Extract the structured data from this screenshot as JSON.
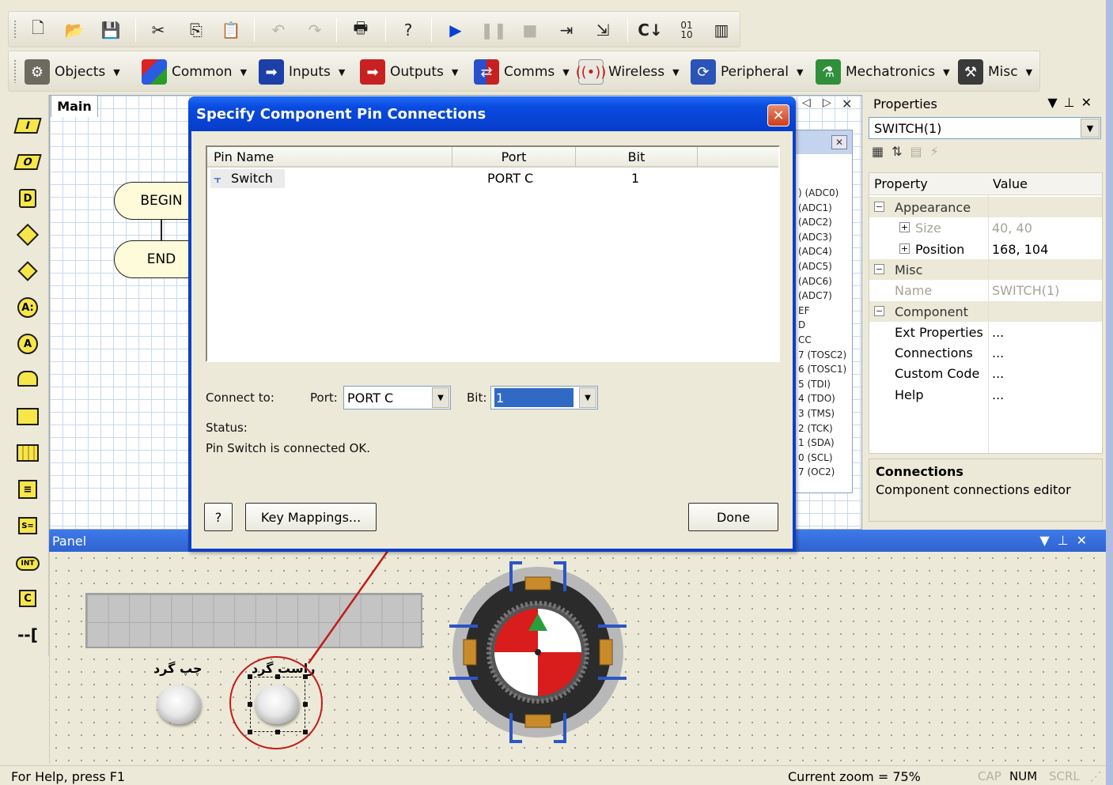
{
  "toolbar_top": {
    "buttons": [
      "new-icon",
      "open-icon",
      "save-icon",
      "cut-icon",
      "copy-icon",
      "paste-icon",
      "undo-icon",
      "redo-icon",
      "print-icon",
      "help-icon",
      "run-icon",
      "pause-icon",
      "stop-icon",
      "step-into-icon",
      "step-over-icon",
      "compile-c-icon",
      "compile-hex-icon",
      "compile-chip-icon"
    ],
    "compile_c_label": "C",
    "hex_label": "01\n10"
  },
  "toolbar_components": {
    "objects": "Objects",
    "common": "Common",
    "inputs": "Inputs",
    "outputs": "Outputs",
    "comms": "Comms",
    "wireless": "Wireless",
    "peripheral": "Peripheral",
    "mechatronics": "Mechatronics",
    "misc": "Misc"
  },
  "palette": {
    "items": [
      "I",
      "O",
      "D",
      "",
      "",
      "A:",
      "A",
      "",
      "",
      "",
      "",
      "S=",
      "INT",
      "C",
      "--["
    ]
  },
  "flowchart": {
    "tab_label": "Main",
    "begin": "BEGIN",
    "end": "END"
  },
  "pin_list": {
    "lines": [
      ") (ADC0)",
      "(ADC1)",
      "(ADC2)",
      "(ADC3)",
      "(ADC4)",
      "(ADC5)",
      "(ADC6)",
      "(ADC7)",
      "EF",
      "D",
      "CC",
      "7 (TOSC2)",
      "6 (TOSC1)",
      "5 (TDI)",
      "4 (TDO)",
      "3 (TMS)",
      "2 (TCK)",
      "1 (SDA)",
      "0 (SCL)",
      "7 (OC2)"
    ]
  },
  "properties": {
    "title": "Properties",
    "component": "SWITCH(1)",
    "col_property": "Property",
    "col_value": "Value",
    "rows": [
      {
        "type": "cat",
        "key": "Appearance"
      },
      {
        "type": "sub",
        "key": "Size",
        "value": "40, 40",
        "dim": true
      },
      {
        "type": "sub",
        "key": "Position",
        "value": "168, 104"
      },
      {
        "type": "cat",
        "key": "Misc"
      },
      {
        "type": "item",
        "key": "Name",
        "value": "SWITCH(1)",
        "dim": true
      },
      {
        "type": "cat",
        "key": "Component"
      },
      {
        "type": "item",
        "key": "Ext Properties",
        "value": "..."
      },
      {
        "type": "item",
        "key": "Connections",
        "value": "..."
      },
      {
        "type": "item",
        "key": "Custom Code",
        "value": "..."
      },
      {
        "type": "item",
        "key": "Help",
        "value": "..."
      }
    ],
    "desc_title": "Connections",
    "desc_text": "Component connections editor"
  },
  "panel": {
    "title": "Panel",
    "label_left": "چپ گرد",
    "label_right": "راست گرد"
  },
  "dialog": {
    "title": "Specify Component Pin Connections",
    "close": "✕",
    "columns": [
      "Pin Name",
      "Port",
      "Bit"
    ],
    "row": {
      "pin": "Switch",
      "port": "PORT C",
      "bit": "1"
    },
    "connect_to": "Connect to:",
    "port_label": "Port:",
    "port_value": "PORT C",
    "bit_label": "Bit:",
    "bit_value": "1",
    "status_label": "Status:",
    "status_text": "Pin Switch is connected OK.",
    "help_btn": "?",
    "key_mappings_btn": "Key Mappings...",
    "done_btn": "Done"
  },
  "status_bar": {
    "help": "For Help, press F1",
    "zoom": "Current zoom = 75%",
    "cap": "CAP",
    "num": "NUM",
    "scrl": "SCRL"
  },
  "colors": {
    "accent": "#0a4be0",
    "annotation": "#c21b1b",
    "grid": "#c9daf0"
  }
}
